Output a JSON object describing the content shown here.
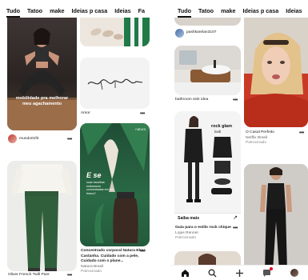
{
  "left": {
    "tabs": [
      "Tudo",
      "Tatoo",
      "make",
      "Ideias p casa",
      "Ideias",
      "Fa"
    ],
    "pin1": {
      "overlay_text": "mobilidade pra melhorar meu agachamento",
      "user": "mundo01fit"
    },
    "pin2": {
      "title": "Amor",
      "art_text": "amor"
    },
    "pin3": {
      "title": "Oliver French Twill Pant"
    },
    "pin4": {
      "brand": "natura",
      "ad_heading": "E se",
      "ad_body": "suas escolhas estivessem concentradas em um frasco?",
      "title": "Concentrado corporal Natura Ekos Castanha. Cuidado com a pele, Cuidado com o plane...",
      "advertiser": "Natura Brasil",
      "sponsored": "Patrocinado"
    }
  },
  "right": {
    "tabs": [
      "Tudo",
      "Tatoo",
      "make",
      "Ideias p casa",
      "Ideias"
    ],
    "pin1": {
      "user": "pashkarelan3107"
    },
    "pin2": {
      "title": "bathroom sink idea"
    },
    "pin3": {
      "title": "O Casal Perfeito",
      "advertiser": "Netflix Brasil",
      "sponsored": "Patrocinado"
    },
    "pin4": {
      "overlay_heading": "rock glam",
      "overlay_sub": "look",
      "cta": "Saiba mais",
      "title": "Guia para o estilo rock chique",
      "advertiser": "Lojas Renner",
      "sponsored": "Patrocinado"
    }
  },
  "more_glyph": "•••",
  "icons": [
    "home-icon",
    "search-icon",
    "plus-icon",
    "chat-icon",
    "profile-avatar"
  ]
}
